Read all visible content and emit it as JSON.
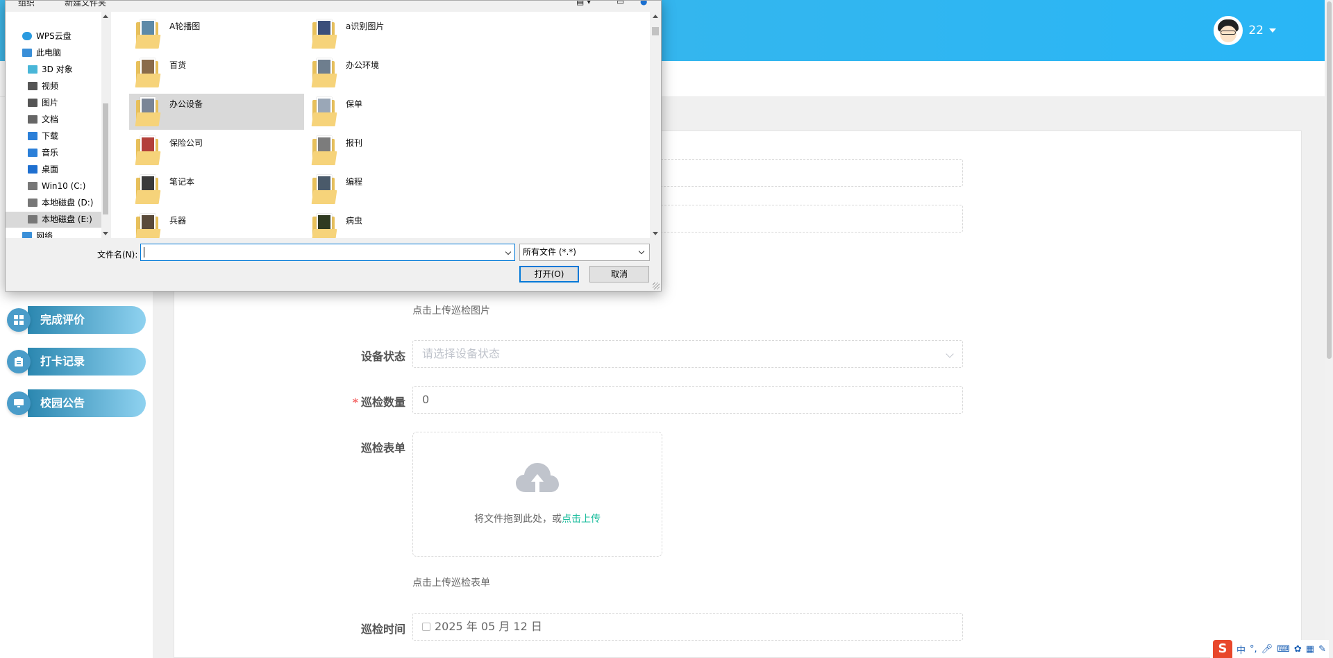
{
  "header": {
    "username": "22"
  },
  "sidebar": {
    "items": [
      {
        "label": "完成评价",
        "icon": "grid-icon"
      },
      {
        "label": "打卡记录",
        "icon": "clipboard-icon"
      },
      {
        "label": "校园公告",
        "icon": "monitor-icon"
      }
    ]
  },
  "form": {
    "image_hint": "点击上传巡检图片",
    "device_status": {
      "label": "设备状态",
      "placeholder": "请选择设备状态"
    },
    "patrol_count": {
      "label": "巡检数量",
      "value": "0"
    },
    "patrol_form": {
      "label": "巡检表单",
      "upload_text": "将文件拖到此处，或",
      "upload_link": "点击上传",
      "hint": "点击上传巡检表单"
    },
    "patrol_time": {
      "label": "巡检时间",
      "value": "2025 年 05 月 12 日"
    }
  },
  "dialog": {
    "toolbar": {
      "organize": "组织",
      "new_folder": "新建文件夹"
    },
    "nav_items": [
      {
        "label": "WPS云盘",
        "icon": "cloud-icon",
        "indent": 1
      },
      {
        "label": "此电脑",
        "icon": "computer-icon",
        "indent": 1
      },
      {
        "label": "3D 对象",
        "icon": "cube-icon",
        "indent": 2
      },
      {
        "label": "视频",
        "icon": "video-icon",
        "indent": 2
      },
      {
        "label": "图片",
        "icon": "image-icon",
        "indent": 2
      },
      {
        "label": "文档",
        "icon": "document-icon",
        "indent": 2
      },
      {
        "label": "下载",
        "icon": "download-icon",
        "indent": 2
      },
      {
        "label": "音乐",
        "icon": "music-icon",
        "indent": 2
      },
      {
        "label": "桌面",
        "icon": "desktop-icon",
        "indent": 2
      },
      {
        "label": "Win10 (C:)",
        "icon": "drive-icon",
        "indent": 2
      },
      {
        "label": "本地磁盘 (D:)",
        "icon": "drive-icon",
        "indent": 2
      },
      {
        "label": "本地磁盘 (E:)",
        "icon": "drive-icon",
        "indent": 2,
        "selected": true
      },
      {
        "label": "网络",
        "icon": "network-icon",
        "indent": 1
      }
    ],
    "files": [
      {
        "name": "A轮播图",
        "col": 0
      },
      {
        "name": "a识别图片",
        "col": 1
      },
      {
        "name": "百货",
        "col": 0
      },
      {
        "name": "办公环境",
        "col": 1
      },
      {
        "name": "办公设备",
        "col": 0,
        "selected": true
      },
      {
        "name": "保单",
        "col": 1
      },
      {
        "name": "保险公司",
        "col": 0
      },
      {
        "name": "报刊",
        "col": 1
      },
      {
        "name": "笔记本",
        "col": 0
      },
      {
        "name": "编程",
        "col": 1
      },
      {
        "name": "兵器",
        "col": 0
      },
      {
        "name": "病虫",
        "col": 1
      }
    ],
    "filename_label": "文件名(N):",
    "filename_value": "",
    "file_type": "所有文件 (*.*)",
    "open_button": "打开(O)",
    "cancel_button": "取消"
  },
  "ime": {
    "mode": "中"
  }
}
